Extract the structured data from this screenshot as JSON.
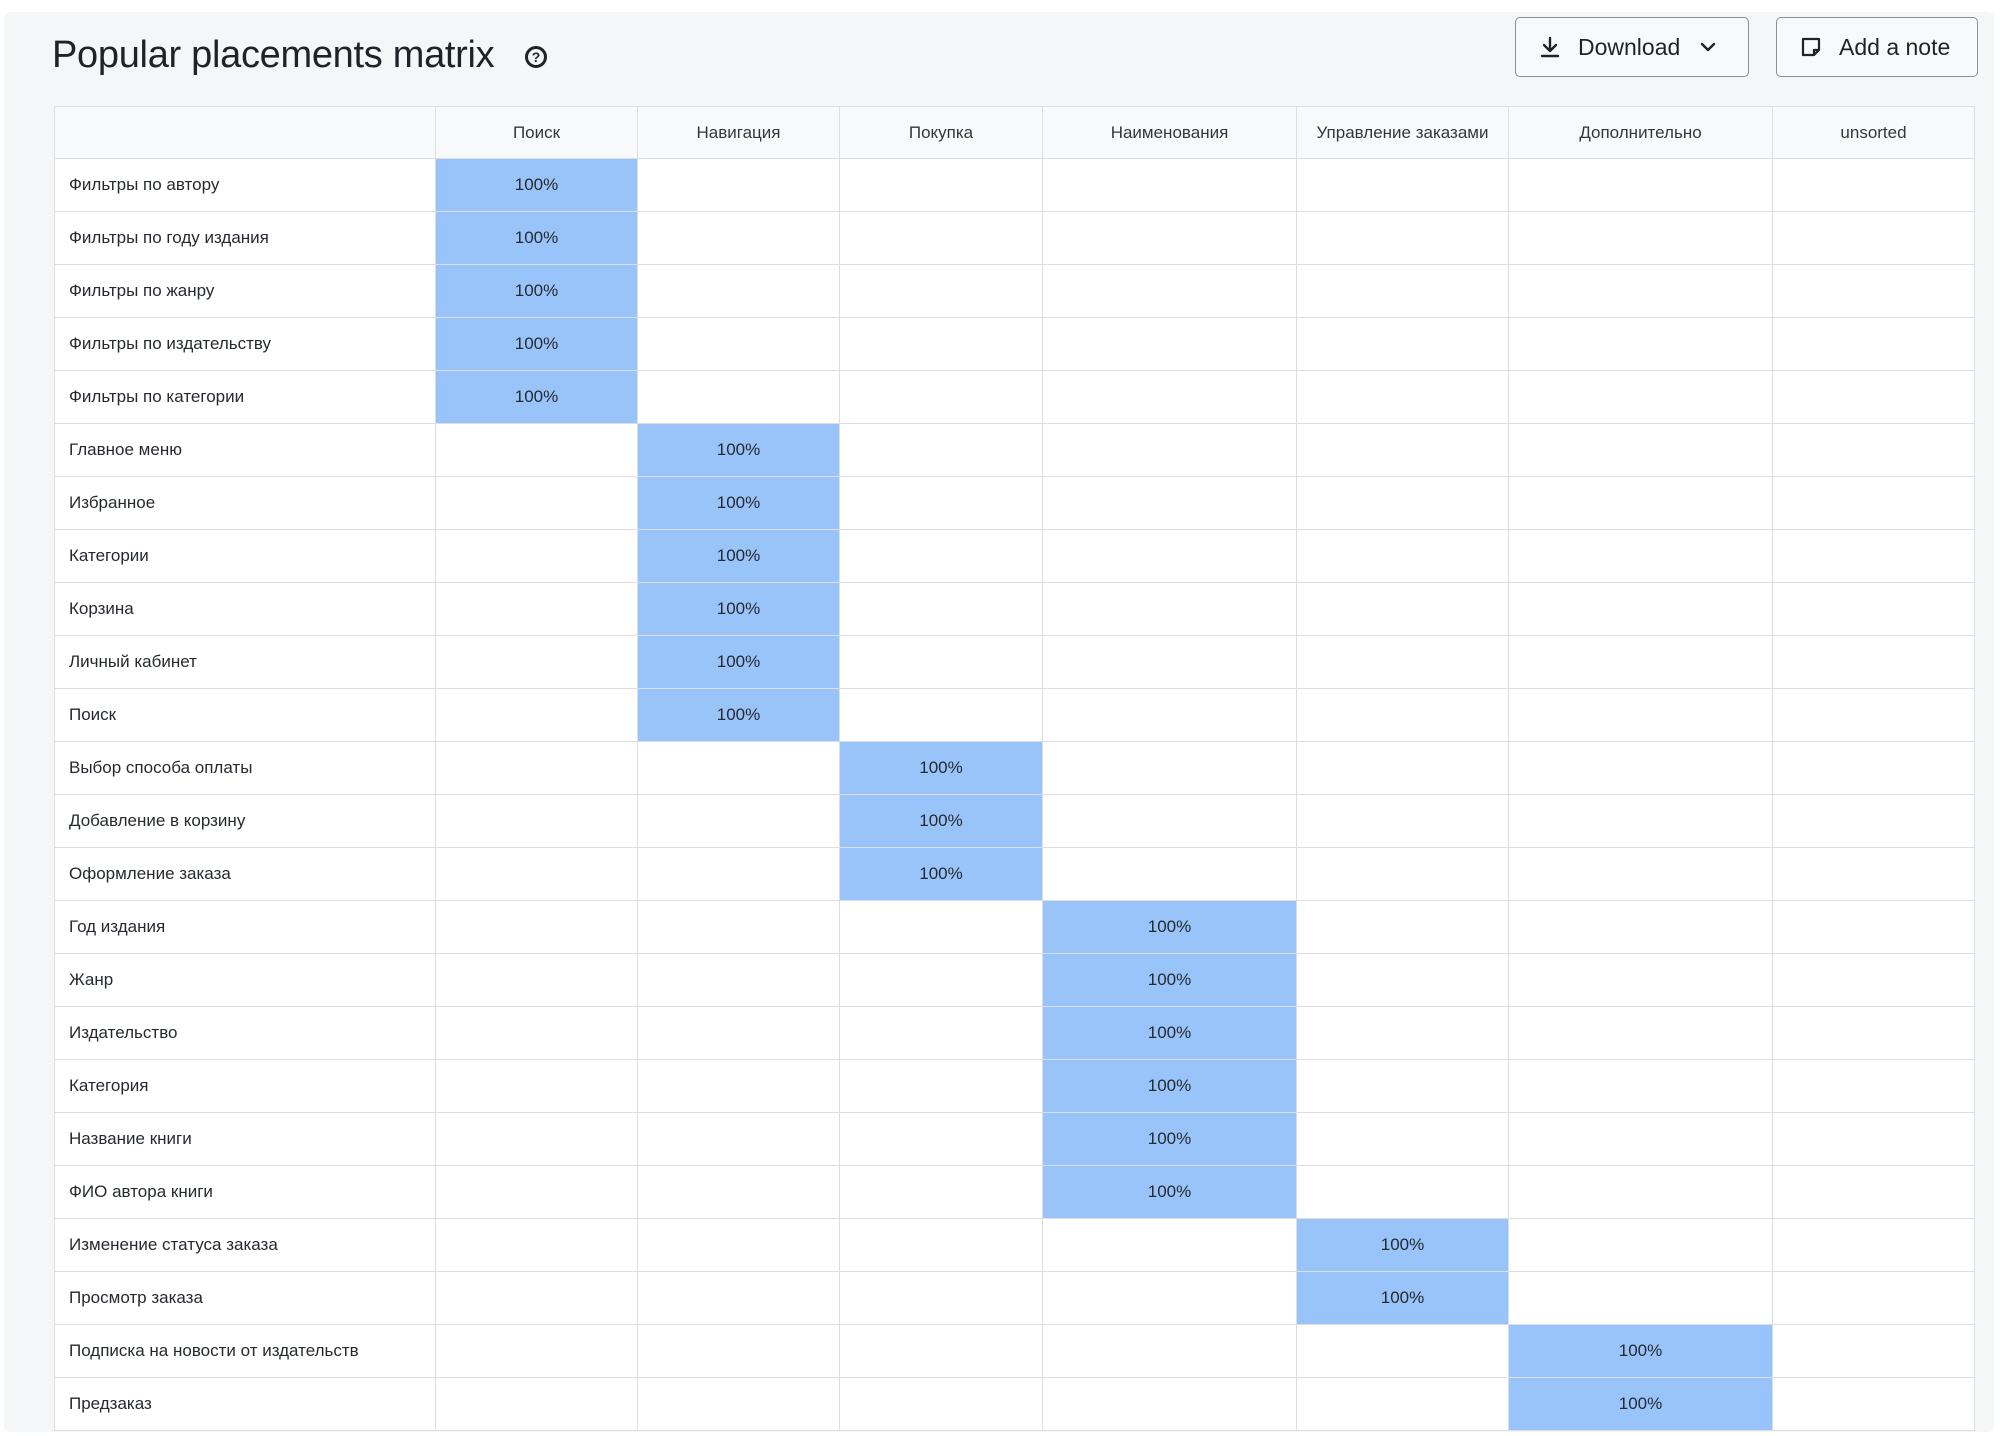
{
  "title": "Popular placements matrix",
  "buttons": {
    "download_label": "Download",
    "note_label": "Add a note"
  },
  "icons": {
    "help": "help-circle-icon",
    "download": "download-icon",
    "chevron": "chevron-down-icon",
    "note": "note-icon"
  },
  "colors": {
    "cell_highlight": "#99c4fa",
    "border": "#dcdee1",
    "background": "#f5f6f7"
  },
  "matrix": {
    "columns": [
      "Поиск",
      "Навигация",
      "Покупка",
      "Наименования",
      "Управление заказами",
      "Дополнительно",
      "unsorted"
    ],
    "rows": [
      {
        "label": "Фильтры по автору",
        "col": 0,
        "value": "100%"
      },
      {
        "label": "Фильтры по году издания",
        "col": 0,
        "value": "100%"
      },
      {
        "label": "Фильтры по жанру",
        "col": 0,
        "value": "100%"
      },
      {
        "label": "Фильтры по издательству",
        "col": 0,
        "value": "100%"
      },
      {
        "label": "Фильтры по категории",
        "col": 0,
        "value": "100%"
      },
      {
        "label": "Главное меню",
        "col": 1,
        "value": "100%"
      },
      {
        "label": "Избранное",
        "col": 1,
        "value": "100%"
      },
      {
        "label": "Категории",
        "col": 1,
        "value": "100%"
      },
      {
        "label": "Корзина",
        "col": 1,
        "value": "100%"
      },
      {
        "label": "Личный кабинет",
        "col": 1,
        "value": "100%"
      },
      {
        "label": "Поиск",
        "col": 1,
        "value": "100%"
      },
      {
        "label": "Выбор способа оплаты",
        "col": 2,
        "value": "100%"
      },
      {
        "label": "Добавление в корзину",
        "col": 2,
        "value": "100%"
      },
      {
        "label": "Оформление заказа",
        "col": 2,
        "value": "100%"
      },
      {
        "label": "Год издания",
        "col": 3,
        "value": "100%"
      },
      {
        "label": "Жанр",
        "col": 3,
        "value": "100%"
      },
      {
        "label": "Издательство",
        "col": 3,
        "value": "100%"
      },
      {
        "label": "Категория",
        "col": 3,
        "value": "100%"
      },
      {
        "label": "Название книги",
        "col": 3,
        "value": "100%"
      },
      {
        "label": "ФИО автора книги",
        "col": 3,
        "value": "100%"
      },
      {
        "label": "Изменение статуса заказа",
        "col": 4,
        "value": "100%"
      },
      {
        "label": "Просмотр заказа",
        "col": 4,
        "value": "100%"
      },
      {
        "label": "Подписка на новости от издательств",
        "col": 5,
        "value": "100%"
      },
      {
        "label": "Предзаказ",
        "col": 5,
        "value": "100%"
      }
    ]
  }
}
